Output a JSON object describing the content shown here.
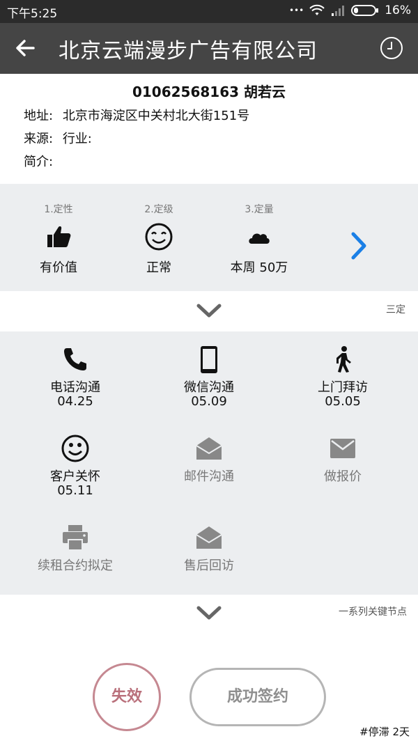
{
  "status_bar": {
    "time": "下午5:25",
    "dots": "•••",
    "battery": "16%"
  },
  "header": {
    "title": "北京云端漫步广告有限公司"
  },
  "contact": {
    "phone_name": "01062568163 胡若云",
    "address_label": "地址:",
    "address": "北京市海淀区中关村北大街151号",
    "source_label": "来源:",
    "industry_label": "行业:",
    "intro_label": "简介:"
  },
  "steps": [
    {
      "label": "1.定性",
      "value": "有价值",
      "icon": "thumbs-up-icon"
    },
    {
      "label": "2.定级",
      "value": "正常",
      "icon": "smile-icon"
    },
    {
      "label": "3.定量",
      "value": "本周 50万",
      "icon": "cloud-icon"
    }
  ],
  "sanding_link": "三定",
  "actions": [
    {
      "label": "电话沟通",
      "date": "04.25",
      "icon": "phone-icon"
    },
    {
      "label": "微信沟通",
      "date": "05.09",
      "icon": "mobile-icon"
    },
    {
      "label": "上门拜访",
      "date": "05.05",
      "icon": "walk-icon"
    },
    {
      "label": "客户关怀",
      "date": "05.11",
      "icon": "smile-icon"
    },
    {
      "label": "邮件沟通",
      "date": "",
      "icon": "envelope-open-icon"
    },
    {
      "label": "做报价",
      "date": "",
      "icon": "envelope-icon"
    },
    {
      "label": "续租合约拟定",
      "date": "",
      "icon": "printer-icon"
    },
    {
      "label": "售后回访",
      "date": "",
      "icon": "envelope-open-icon"
    }
  ],
  "key_nodes_link": "一系列关键节点",
  "buttons": {
    "fail": "失效",
    "success": "成功签约"
  },
  "stagnation": "#停滞 2天",
  "colors": {
    "accent_blue": "#1a7fe6",
    "fail_border": "#c58891",
    "panel_bg": "#eceef0"
  }
}
